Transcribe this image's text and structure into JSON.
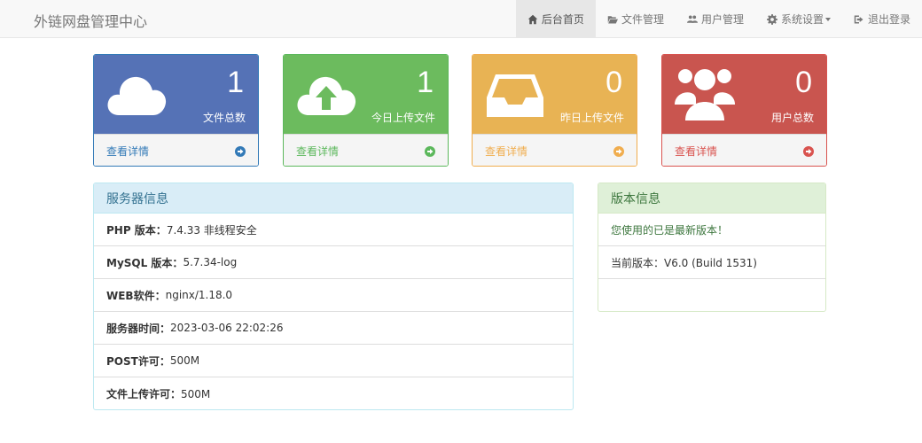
{
  "navbar": {
    "brand": "外链网盘管理中心",
    "items": [
      {
        "label": "后台首页",
        "icon": "home-icon",
        "active": true
      },
      {
        "label": "文件管理",
        "icon": "folder-open-icon"
      },
      {
        "label": "用户管理",
        "icon": "users-icon"
      },
      {
        "label": "系统设置",
        "icon": "gear-icon",
        "dropdown": true
      },
      {
        "label": "退出登录",
        "icon": "logout-icon"
      }
    ]
  },
  "stats": [
    {
      "count": "1",
      "label": "文件总数",
      "link": "查看详情",
      "icon": "cloud-icon",
      "color": "#5572b6"
    },
    {
      "count": "1",
      "label": "今日上传文件",
      "link": "查看详情",
      "icon": "cloud-upload-icon",
      "color": "#6cbb5e"
    },
    {
      "count": "0",
      "label": "昨日上传文件",
      "link": "查看详情",
      "icon": "inbox-icon",
      "color": "#e8b354"
    },
    {
      "count": "0",
      "label": "用户总数",
      "link": "查看详情",
      "icon": "users-icon",
      "color": "#c9554f"
    }
  ],
  "server_panel": {
    "title": "服务器信息",
    "rows": [
      {
        "key": "PHP 版本：",
        "value": "7.4.33 非线程安全"
      },
      {
        "key": "MySQL 版本：",
        "value": "5.7.34-log"
      },
      {
        "key": "WEB软件：",
        "value": "nginx/1.18.0"
      },
      {
        "key": "服务器时间：",
        "value": "2023-03-06 22:02:26"
      },
      {
        "key": "POST许可：",
        "value": "500M"
      },
      {
        "key": "文件上传许可：",
        "value": "500M"
      }
    ]
  },
  "version_panel": {
    "title": "版本信息",
    "status": "您使用的已是最新版本！",
    "current": "当前版本：V6.0 (Build 1531)",
    "empty": ""
  }
}
